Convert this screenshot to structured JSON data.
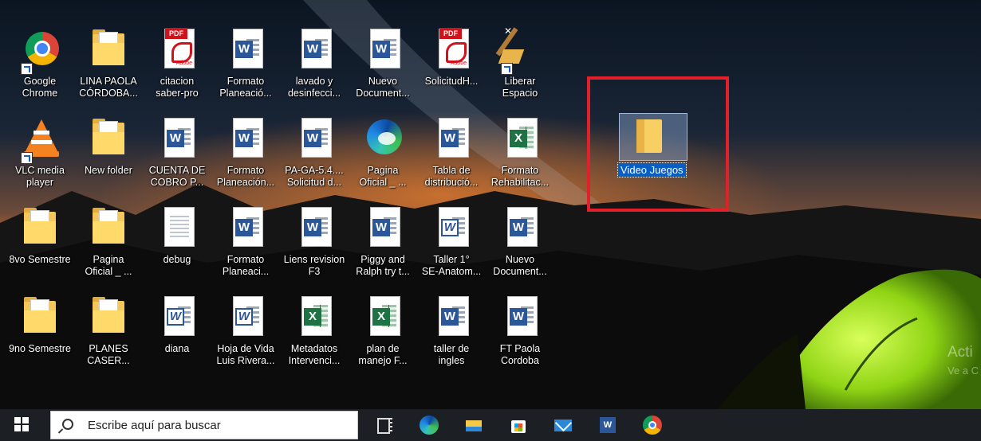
{
  "desktop_icons": [
    {
      "label": "Google\nChrome",
      "icon": "chrome-icon"
    },
    {
      "label": "LINA PAOLA\nCÓRDOBA...",
      "icon": "folder-icon"
    },
    {
      "label": "citacion\nsaber-pro",
      "icon": "pdf-icon"
    },
    {
      "label": "Formato\nPlaneació...",
      "icon": "word-icon"
    },
    {
      "label": "lavado y\ndesinfecci...",
      "icon": "word-icon"
    },
    {
      "label": "Nuevo\nDocument...",
      "icon": "word-icon"
    },
    {
      "label": "SolicitudH...",
      "icon": "pdf-icon"
    },
    {
      "label": "Liberar\nEspacio",
      "icon": "broom-icon"
    },
    {
      "label": "VLC media\nplayer",
      "icon": "vlc-icon"
    },
    {
      "label": "New folder",
      "icon": "folder-icon"
    },
    {
      "label": "CUENTA DE\nCOBRO P...",
      "icon": "word-icon"
    },
    {
      "label": "Formato\nPlaneación...",
      "icon": "word-icon"
    },
    {
      "label": "PA-GA-5.4....\nSolicitud d...",
      "icon": "word-icon"
    },
    {
      "label": "Pagina\nOficial _ ...",
      "icon": "edge-icon"
    },
    {
      "label": "Tabla de\ndistribució...",
      "icon": "word-icon"
    },
    {
      "label": "Formato\nRehabilitac...",
      "icon": "excel-icon"
    },
    {
      "label": "8vo Semestre",
      "icon": "folder-icon"
    },
    {
      "label": "Pagina\nOficial _ ...",
      "icon": "folder-icon"
    },
    {
      "label": "debug",
      "icon": "text-file-icon"
    },
    {
      "label": "Formato\nPlaneaci...",
      "icon": "word-icon"
    },
    {
      "label": "Liens revision\nF3",
      "icon": "word-icon"
    },
    {
      "label": "Piggy and\nRalph try t...",
      "icon": "word-icon"
    },
    {
      "label": "Taller 1°\nSE-Anatom...",
      "icon": "word-old-icon"
    },
    {
      "label": "Nuevo\nDocument...",
      "icon": "word-icon"
    },
    {
      "label": "9no Semestre",
      "icon": "folder-icon"
    },
    {
      "label": "PLANES\nCASER...",
      "icon": "folder-icon"
    },
    {
      "label": "diana",
      "icon": "word-old-icon"
    },
    {
      "label": "Hoja de Vida\nLuis Rivera...",
      "icon": "word-old-icon"
    },
    {
      "label": "Metadatos\nIntervenci...",
      "icon": "excel-icon"
    },
    {
      "label": "plan de\nmanejo F...",
      "icon": "excel-icon"
    },
    {
      "label": "taller de\ningles",
      "icon": "word-icon"
    },
    {
      "label": "FT Paola\nCordoba",
      "icon": "word-icon"
    }
  ],
  "selected_folder": {
    "label": "Video Juegos",
    "icon": "folder-icon",
    "highlight_color": "#e0202b"
  },
  "watermark": {
    "title": "Acti",
    "subtitle": "Ve a C"
  },
  "taskbar": {
    "search_placeholder": "Escribe aquí para buscar",
    "pinned": [
      "task-view-icon",
      "edge-icon",
      "file-explorer-icon",
      "store-icon",
      "mail-icon",
      "word-icon",
      "chrome-icon"
    ]
  },
  "colors": {
    "taskbar": "#1c2024",
    "selection": "#0a5dc2",
    "accent_red": "#e0202b"
  }
}
